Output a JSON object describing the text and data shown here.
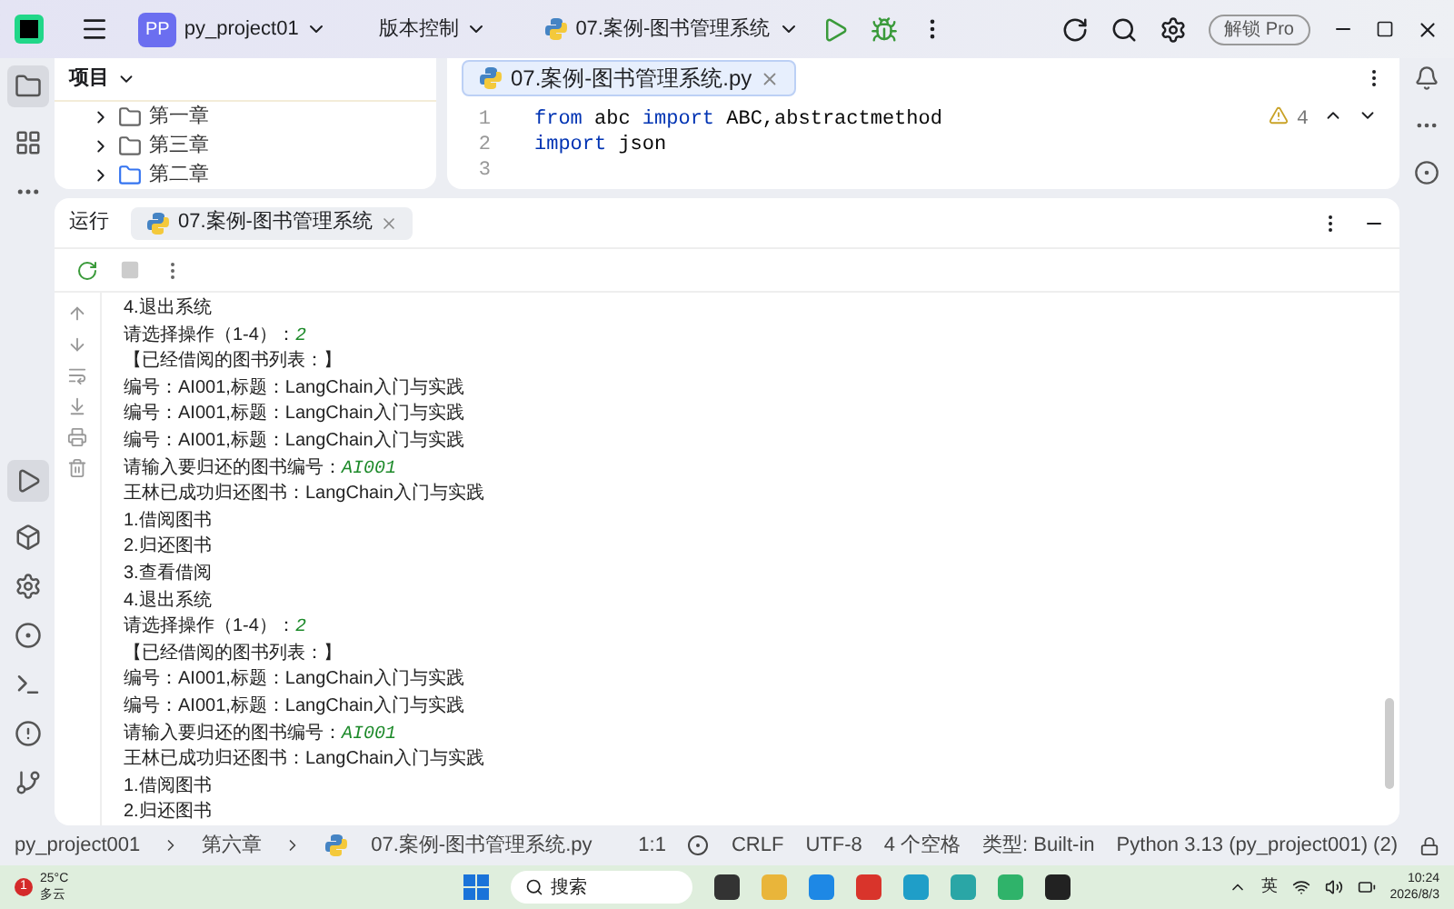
{
  "title_bar": {
    "project_badge": "PP",
    "project": "py_project01",
    "vcs": "版本控制",
    "run_config": "07.案例-图书管理系统",
    "pro_button": "解锁 Pro"
  },
  "project_panel": {
    "title": "项目",
    "items": [
      {
        "label": "第一章",
        "selected": false
      },
      {
        "label": "第三章",
        "selected": false
      },
      {
        "label": "第二章",
        "selected": true
      }
    ]
  },
  "editor": {
    "tab": "07.案例-图书管理系统.py",
    "warnings": "4",
    "lines": [
      {
        "number": "1",
        "tokens": [
          {
            "kind": "keyword",
            "text": "from"
          },
          {
            "kind": "plain",
            "text": " abc "
          },
          {
            "kind": "keyword",
            "text": "import"
          },
          {
            "kind": "plain",
            "text": " ABC,abstractmethod"
          }
        ]
      },
      {
        "number": "2",
        "tokens": [
          {
            "kind": "keyword",
            "text": "import"
          },
          {
            "kind": "plain",
            "text": " json"
          }
        ]
      },
      {
        "number": "3"
      }
    ]
  },
  "run_panel": {
    "title": "运行",
    "tab": "07.案例-图书管理系统",
    "output": [
      {
        "text": "4.退出系统"
      },
      {
        "text": "请选择操作（1-4）：",
        "input": "2"
      },
      {
        "text": "【已经借阅的图书列表：】"
      },
      {
        "text": "编号：AI001,标题：LangChain入门与实践"
      },
      {
        "text": "编号：AI001,标题：LangChain入门与实践"
      },
      {
        "text": "编号：AI001,标题：LangChain入门与实践"
      },
      {
        "text": "请输入要归还的图书编号：",
        "input": "AI001"
      },
      {
        "text": "王林已成功归还图书：LangChain入门与实践"
      },
      {
        "text": "1.借阅图书"
      },
      {
        "text": "2.归还图书"
      },
      {
        "text": "3.查看借阅"
      },
      {
        "text": "4.退出系统"
      },
      {
        "text": "请选择操作（1-4）：",
        "input": "2"
      },
      {
        "text": "【已经借阅的图书列表：】"
      },
      {
        "text": "编号：AI001,标题：LangChain入门与实践"
      },
      {
        "text": "编号：AI001,标题：LangChain入门与实践"
      },
      {
        "text": "请输入要归还的图书编号：",
        "input": "AI001"
      },
      {
        "text": "王林已成功归还图书：LangChain入门与实践"
      },
      {
        "text": "1.借阅图书"
      },
      {
        "text": "2.归还图书"
      }
    ]
  },
  "status_bar": {
    "breadcrumbs": [
      "py_project001",
      "第六章",
      "07.案例-图书管理系统.py"
    ],
    "position": "1:1",
    "line_ending": "CRLF",
    "encoding": "UTF-8",
    "indent": "4 个空格",
    "type": "类型: Built-in",
    "interpreter": "Python 3.13 (py_project001) (2)"
  },
  "taskbar": {
    "temperature": "25°C",
    "weather": "多云",
    "weather_badge": "1",
    "search": "搜索",
    "language": "英",
    "time": "10:24",
    "date": "2026/8/3"
  }
}
